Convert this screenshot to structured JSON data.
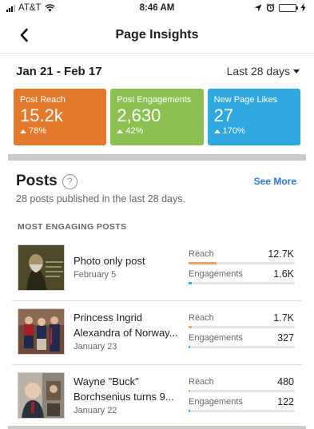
{
  "status_bar": {
    "carrier": "AT&T",
    "time": "8:46 AM"
  },
  "nav": {
    "title": "Page Insights"
  },
  "date_range": {
    "range": "Jan 21 - Feb 17",
    "period": "Last 28 days"
  },
  "tiles": [
    {
      "label": "Post Reach",
      "value": "15.2k",
      "change": "78%",
      "color": "#e5792b"
    },
    {
      "label": "Post Engagements",
      "value": "2,630",
      "change": "42%",
      "color": "#8cc152"
    },
    {
      "label": "New Page Likes",
      "value": "27",
      "change": "170%",
      "color": "#2fa8df"
    }
  ],
  "posts_section": {
    "title": "Posts",
    "see_more": "See More",
    "subtitle": "28 posts published in the last 28 days.",
    "list_label": "MOST ENGAGING POSTS",
    "reach_label": "Reach",
    "engagements_label": "Engagements",
    "reach_color": "#f0a35e",
    "engagement_color": "#2fa8df",
    "posts": [
      {
        "title_line1": "Photo only post",
        "title_line2": "",
        "date": "February 5",
        "reach": "12.7K",
        "engagements": "1.6K",
        "reach_fraction": 0.26,
        "engagement_fraction": 0.03
      },
      {
        "title_line1": "Princess Ingrid",
        "title_line2": "Alexandra of Norway...",
        "date": "January 23",
        "reach": "1.7K",
        "engagements": "327",
        "reach_fraction": 0.03,
        "engagement_fraction": 0.008
      },
      {
        "title_line1": "Wayne \"Buck\"",
        "title_line2": "Borchsenius turns 9...",
        "date": "January 22",
        "reach": "480",
        "engagements": "122",
        "reach_fraction": 0.01,
        "engagement_fraction": 0.004
      }
    ]
  }
}
